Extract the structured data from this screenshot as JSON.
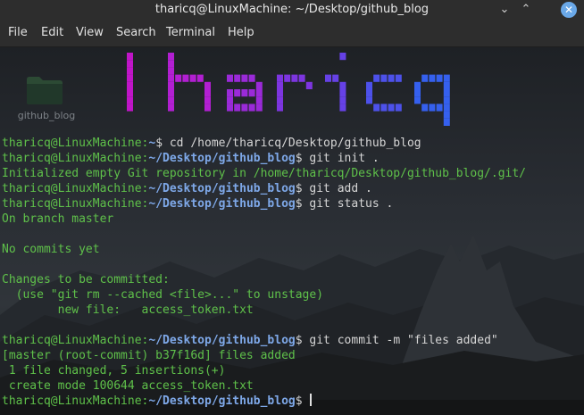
{
  "window": {
    "title": "tharicq@LinuxMachine: ~/Desktop/github_blog",
    "minimize_glyph": "⌄",
    "maximize_glyph": "⌃",
    "close_glyph": "✕"
  },
  "menu": {
    "items": [
      "File",
      "Edit",
      "View",
      "Search",
      "Terminal",
      "Help"
    ]
  },
  "desktop": {
    "folder_label": "github_blog"
  },
  "banner": {
    "text": "lharicq",
    "colors": [
      "#c015c8",
      "#b21fd2",
      "#9a2ad8",
      "#7d35e0",
      "#6641e6",
      "#4d51ea",
      "#3560ee"
    ]
  },
  "colors": {
    "prompt_user": "#5fc14a",
    "prompt_path": "#7ea8e8",
    "output": "#5fc14a"
  },
  "terminal": {
    "lines": [
      {
        "user": "tharicq@LinuxMachine:",
        "path": "~",
        "cmd": "$ cd /home/tharicq/Desktop/github_blog"
      },
      {
        "user": "tharicq@LinuxMachine:",
        "path": "~/Desktop/github_blog",
        "cmd": "$ git init ."
      },
      {
        "out": "Initialized empty Git repository in /home/tharicq/Desktop/github_blog/.git/"
      },
      {
        "user": "tharicq@LinuxMachine:",
        "path": "~/Desktop/github_blog",
        "cmd": "$ git add ."
      },
      {
        "user": "tharicq@LinuxMachine:",
        "path": "~/Desktop/github_blog",
        "cmd": "$ git status ."
      },
      {
        "out": "On branch master"
      },
      {
        "out": ""
      },
      {
        "out": "No commits yet"
      },
      {
        "out": ""
      },
      {
        "out": "Changes to be committed:"
      },
      {
        "out": "  (use \"git rm --cached <file>...\" to unstage)"
      },
      {
        "out": "\tnew file:   access_token.txt"
      },
      {
        "out": ""
      },
      {
        "user": "tharicq@LinuxMachine:",
        "path": "~/Desktop/github_blog",
        "cmd": "$ git commit -m \"files added\""
      },
      {
        "out": "[master (root-commit) b37f16d] files added"
      },
      {
        "out": " 1 file changed, 5 insertions(+)"
      },
      {
        "out": " create mode 100644 access_token.txt"
      },
      {
        "user": "tharicq@LinuxMachine:",
        "path": "~/Desktop/github_blog",
        "cmd": "$ ",
        "cursor": true
      }
    ]
  }
}
